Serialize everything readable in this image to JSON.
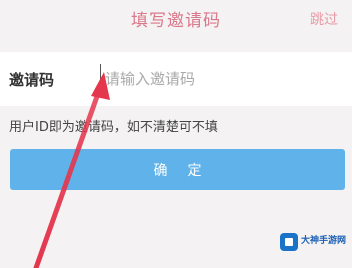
{
  "header": {
    "title": "填写邀请码",
    "skip_label": "跳过"
  },
  "form": {
    "label": "邀请码",
    "placeholder": "请输入邀请码",
    "value": ""
  },
  "hint": "用户ID即为邀请码，如不清楚可不填",
  "confirm_label": "确定",
  "watermark": {
    "text": "大神手游网",
    "icon": "app-logo-icon"
  },
  "colors": {
    "title": "#d9788a",
    "button": "#5fb3ea",
    "arrow": "#e4364d"
  }
}
